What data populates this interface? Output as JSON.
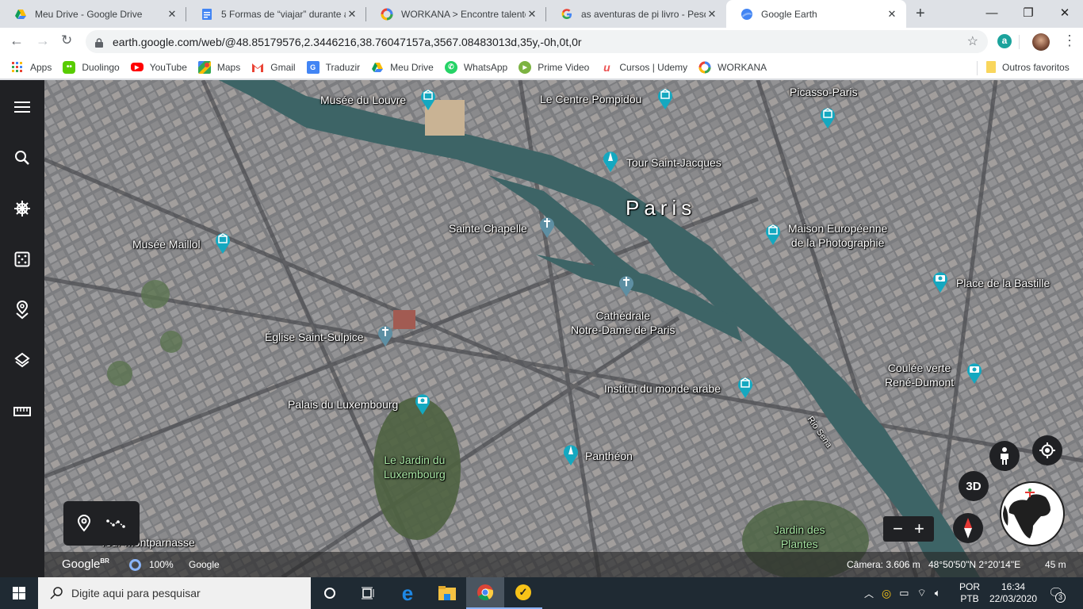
{
  "browser": {
    "tabs": [
      {
        "title": "Meu Drive - Google Drive",
        "icon": "google-drive-icon",
        "active": false
      },
      {
        "title": "5 Formas de “viajar” durante a",
        "icon": "google-docs-icon",
        "active": false
      },
      {
        "title": "WORKANA > Encontre talento",
        "icon": "workana-icon",
        "active": false
      },
      {
        "title": "as aventuras de pi livro - Pesqu",
        "icon": "google-icon",
        "active": false
      },
      {
        "title": "Google Earth",
        "icon": "google-earth-icon",
        "active": true
      }
    ],
    "new_tab": "+",
    "window_controls": {
      "minimize": "—",
      "maximize": "❐",
      "close": "✕"
    },
    "url": "earth.google.com/web/@48.85179576,2.3446216,38.76047157a,3567.08483013d,35y,-0h,0t,0r",
    "extension_badge": "a",
    "bookmarks": [
      {
        "label": "Apps",
        "icon": "apps-grid-icon",
        "color": "#ea4335"
      },
      {
        "label": "Duolingo",
        "icon": "duolingo-icon",
        "color": "#58cc02"
      },
      {
        "label": "YouTube",
        "icon": "youtube-icon",
        "color": "#ff0000"
      },
      {
        "label": "Maps",
        "icon": "maps-icon",
        "color": "#34a853"
      },
      {
        "label": "Gmail",
        "icon": "gmail-icon",
        "color": "#ea4335"
      },
      {
        "label": "Traduzir",
        "icon": "translate-icon",
        "color": "#4285f4"
      },
      {
        "label": "Meu Drive",
        "icon": "google-drive-icon",
        "color": "#fbbc04"
      },
      {
        "label": "WhatsApp",
        "icon": "whatsapp-icon",
        "color": "#25d366"
      },
      {
        "label": "Prime Video",
        "icon": "prime-video-icon",
        "color": "#7cb342"
      },
      {
        "label": "Cursos | Udemy",
        "icon": "udemy-icon",
        "color": "#ec5252"
      },
      {
        "label": "WORKANA",
        "icon": "workana-icon",
        "color": "#4285f4"
      }
    ],
    "other_bookmarks": "Outros favoritos"
  },
  "earth": {
    "sidebar": [
      {
        "name": "menu",
        "icon": "hamburger-menu-icon"
      },
      {
        "name": "search",
        "icon": "search-icon"
      },
      {
        "name": "voyager",
        "icon": "ship-wheel-icon"
      },
      {
        "name": "feeling-lucky",
        "icon": "dice-icon"
      },
      {
        "name": "my-places",
        "icon": "map-pin-icon"
      },
      {
        "name": "map-style",
        "icon": "layers-icon"
      },
      {
        "name": "measure",
        "icon": "ruler-icon"
      }
    ],
    "city": "Paris",
    "river": "Rio Sena",
    "places": [
      {
        "name": "Musée du Louvre",
        "type": "museum"
      },
      {
        "name": "Le Centre Pompidou",
        "type": "museum"
      },
      {
        "name": "Picasso-Paris",
        "type": "museum"
      },
      {
        "name": "Tour Saint-Jacques",
        "type": "monument"
      },
      {
        "name": "Sainte Chapelle",
        "type": "church"
      },
      {
        "name": "Maison Européenne",
        "name2": "de la Photographie",
        "type": "museum"
      },
      {
        "name": "Musée Maillol",
        "type": "museum"
      },
      {
        "name": "Place de la Bastille",
        "type": "photo"
      },
      {
        "name": "Cathédrale",
        "name2": "Notre-Dame de Paris",
        "type": "church"
      },
      {
        "name": "Église Saint-Sulpice",
        "type": "church"
      },
      {
        "name": "Coulée verte",
        "name2": "René-Dumont",
        "type": "photo"
      },
      {
        "name": "Institut du monde arabe",
        "type": "museum"
      },
      {
        "name": "Palais du Luxembourg",
        "type": "photo"
      },
      {
        "name": "Panthéon",
        "type": "monument"
      }
    ],
    "parks": [
      {
        "name": "Le Jardin du",
        "name2": "Luxembourg"
      },
      {
        "name": "Jardin des",
        "name2": "Plantes"
      }
    ],
    "partial_label": "Tour Montparnasse",
    "controls": {
      "view_3d": "3D",
      "zoom_out": "−",
      "zoom_in": "+"
    },
    "status": {
      "logo": "Google",
      "logo_sup": "BR",
      "loading": "100%",
      "attribution": "Google",
      "camera": "Câmera: 3.606 m",
      "coords": "48°50'50\"N 2°20'14\"E",
      "scale": "45 m"
    }
  },
  "taskbar": {
    "search_placeholder": "Digite aqui para pesquisar",
    "language_top": "POR",
    "language_bottom": "PTB",
    "time": "16:34",
    "date": "22/03/2020",
    "notifications": "3"
  }
}
